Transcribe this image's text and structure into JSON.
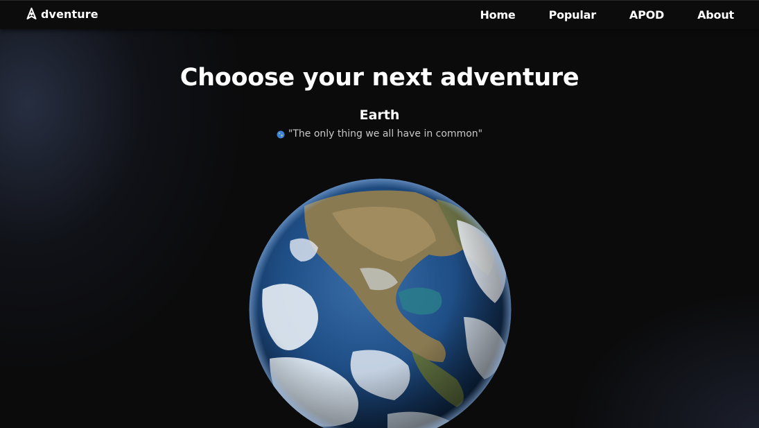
{
  "navbar": {
    "brand": {
      "icon": "rocket-logo-icon",
      "text": "dventure"
    },
    "links": [
      "Home",
      "Popular",
      "APOD",
      "About"
    ]
  },
  "hero": {
    "headline": "Chooose your next adventure",
    "planet_name": "Earth",
    "tagline_icon": "globe-icon",
    "tagline": "\"The only thing we all have in common\""
  },
  "planet_image": {
    "subject": "earth-globe-image"
  },
  "colors": {
    "background": "#0b0b0c",
    "navbar": "#0c0c0d",
    "text": "#ffffff",
    "tagline_text": "#c9c9c9",
    "ocean": "#1f4e86"
  }
}
